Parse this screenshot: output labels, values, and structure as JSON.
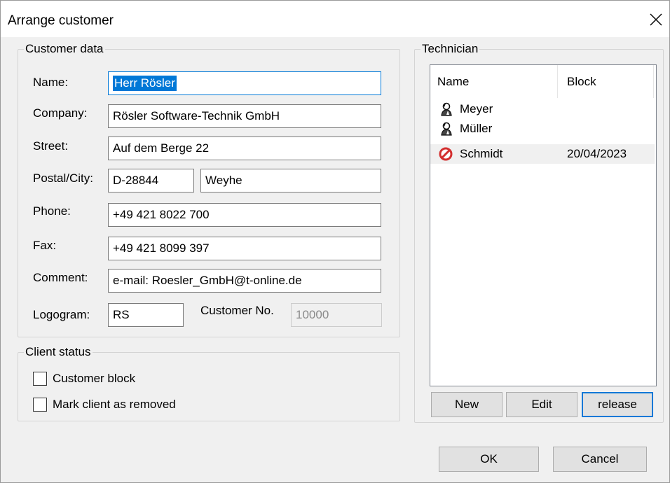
{
  "window": {
    "title": "Arrange customer",
    "close_icon": "close-icon"
  },
  "customer_data": {
    "legend": "Customer data",
    "name": {
      "label": "Name:",
      "value": "Herr Rösler"
    },
    "company": {
      "label": "Company:",
      "value": "Rösler Software-Technik GmbH"
    },
    "street": {
      "label": "Street:",
      "value": "Auf dem Berge 22"
    },
    "postal_city": {
      "label": "Postal/City:",
      "postal": "D-28844",
      "city": "Weyhe"
    },
    "phone": {
      "label": "Phone:",
      "value": "+49 421 8022 700"
    },
    "fax": {
      "label": "Fax:",
      "value": "+49 421 8099 397"
    },
    "comment": {
      "label": "Comment:",
      "value": "e-mail: Roesler_GmbH@t-online.de"
    },
    "logogram": {
      "label": "Logogram:",
      "value": "RS"
    },
    "customer_no": {
      "label": "Customer No.",
      "value": "10000"
    }
  },
  "client_status": {
    "legend": "Client status",
    "customer_block": {
      "label": "Customer block",
      "checked": false
    },
    "mark_removed": {
      "label": "Mark client as removed",
      "checked": false
    }
  },
  "technician": {
    "legend": "Technician",
    "columns": {
      "name": "Name",
      "block": "Block"
    },
    "rows": [
      {
        "name": "Meyer",
        "block": "",
        "icon": "technician-icon"
      },
      {
        "name": "Müller",
        "block": "",
        "icon": "technician-icon"
      },
      {
        "name": "Schmidt",
        "block": "20/04/2023",
        "icon": "blocked-icon"
      }
    ],
    "buttons": {
      "new": "New",
      "edit": "Edit",
      "release": "release"
    }
  },
  "footer": {
    "ok": "OK",
    "cancel": "Cancel"
  },
  "colors": {
    "accent": "#0078d7",
    "blocked": "#d32f2f",
    "dialog_bg": "#f0f0f0"
  }
}
